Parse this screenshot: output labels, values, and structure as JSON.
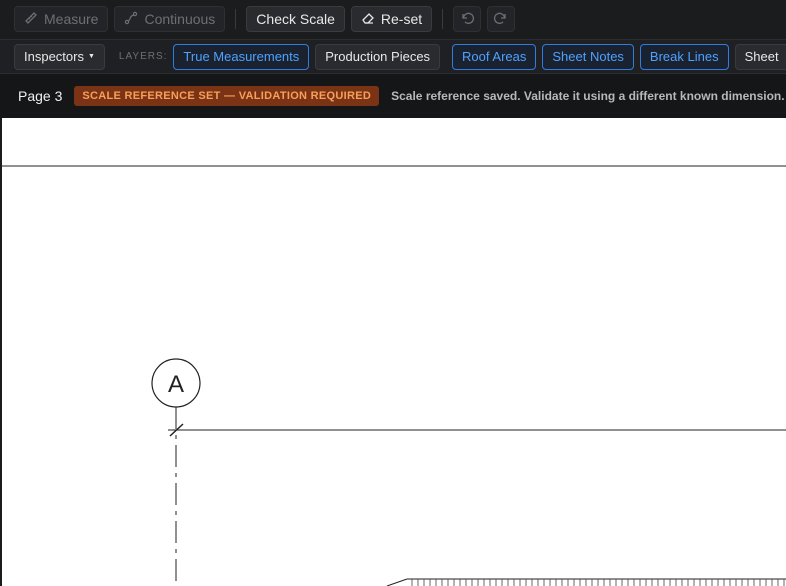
{
  "toolbar": {
    "measure_label": "Measure",
    "continuous_label": "Continuous",
    "check_scale_label": "Check Scale",
    "reset_label": "Re-set",
    "icons": [
      "ruler-icon",
      "path-icon",
      "eraser-icon",
      "undo-icon",
      "redo-icon"
    ]
  },
  "layerbar": {
    "inspectors_label": "Inspectors",
    "layers_label": "LAYERS:",
    "chips": [
      {
        "label": "True Measurements",
        "active": true
      },
      {
        "label": "Production Pieces",
        "active": false
      },
      {
        "label": "Roof Areas",
        "active": true
      },
      {
        "label": "Sheet Notes",
        "active": true
      },
      {
        "label": "Break Lines",
        "active": true
      },
      {
        "label": "Sheet",
        "active": false
      }
    ]
  },
  "status": {
    "page": "Page 3",
    "badge": "SCALE REFERENCE SET — VALIDATION REQUIRED",
    "message": "Scale reference saved. Validate it using a different known dimension."
  },
  "drawing": {
    "grid_bubble_label": "A"
  },
  "colors": {
    "accent_blue": "#4ea1ff",
    "warning_bg": "#7a3314",
    "warning_text": "#f6a05a"
  }
}
